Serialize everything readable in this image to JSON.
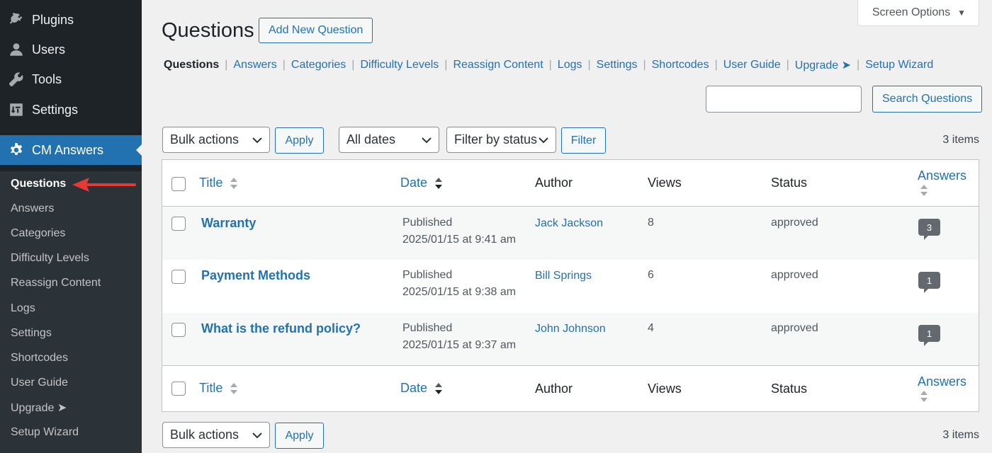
{
  "sidebar": {
    "top_items": [
      {
        "label": "Plugins",
        "icon": "plugin-icon"
      },
      {
        "label": "Users",
        "icon": "users-icon"
      },
      {
        "label": "Tools",
        "icon": "wrench-icon"
      },
      {
        "label": "Settings",
        "icon": "settings-icon"
      }
    ],
    "active_menu": {
      "label": "CM Answers",
      "icon": "gear-icon"
    },
    "submenu": [
      "Questions",
      "Answers",
      "Categories",
      "Difficulty Levels",
      "Reassign Content",
      "Logs",
      "Settings",
      "Shortcodes",
      "User Guide",
      "Upgrade ➤",
      "Setup Wizard"
    ],
    "current_submenu": "Questions"
  },
  "header": {
    "screen_options": "Screen Options",
    "title": "Questions",
    "add_new": "Add New Question"
  },
  "subnav": {
    "current": "Questions",
    "links": [
      "Answers",
      "Categories",
      "Difficulty Levels",
      "Reassign Content",
      "Logs",
      "Settings",
      "Shortcodes",
      "User Guide",
      "Upgrade ➤",
      "Setup Wizard"
    ]
  },
  "search": {
    "value": "",
    "button": "Search Questions"
  },
  "toolbar_top": {
    "bulk_actions": "Bulk actions",
    "apply": "Apply",
    "dates": "All dates",
    "status_filter": "Filter by status",
    "filter": "Filter",
    "count": "3 items"
  },
  "table": {
    "columns": {
      "title": "Title",
      "date": "Date",
      "author": "Author",
      "views": "Views",
      "status": "Status",
      "answers": "Answers"
    },
    "rows": [
      {
        "title": "Warranty",
        "date_status": "Published",
        "date": "2025/01/15 at 9:41 am",
        "author": "Jack Jackson",
        "views": "8",
        "status": "approved",
        "answers": "3"
      },
      {
        "title": "Payment Methods",
        "date_status": "Published",
        "date": "2025/01/15 at 9:38 am",
        "author": "Bill Springs",
        "views": "6",
        "status": "approved",
        "answers": "1"
      },
      {
        "title": "What is the refund policy?",
        "date_status": "Published",
        "date": "2025/01/15 at 9:37 am",
        "author": "John Johnson",
        "views": "4",
        "status": "approved",
        "answers": "1"
      }
    ]
  },
  "toolbar_bottom": {
    "bulk_actions": "Bulk actions",
    "apply": "Apply",
    "count": "3 items"
  },
  "colors": {
    "accent": "#2271b1",
    "sidebar": "#1d2327",
    "annotation_arrow": "#e53935"
  }
}
